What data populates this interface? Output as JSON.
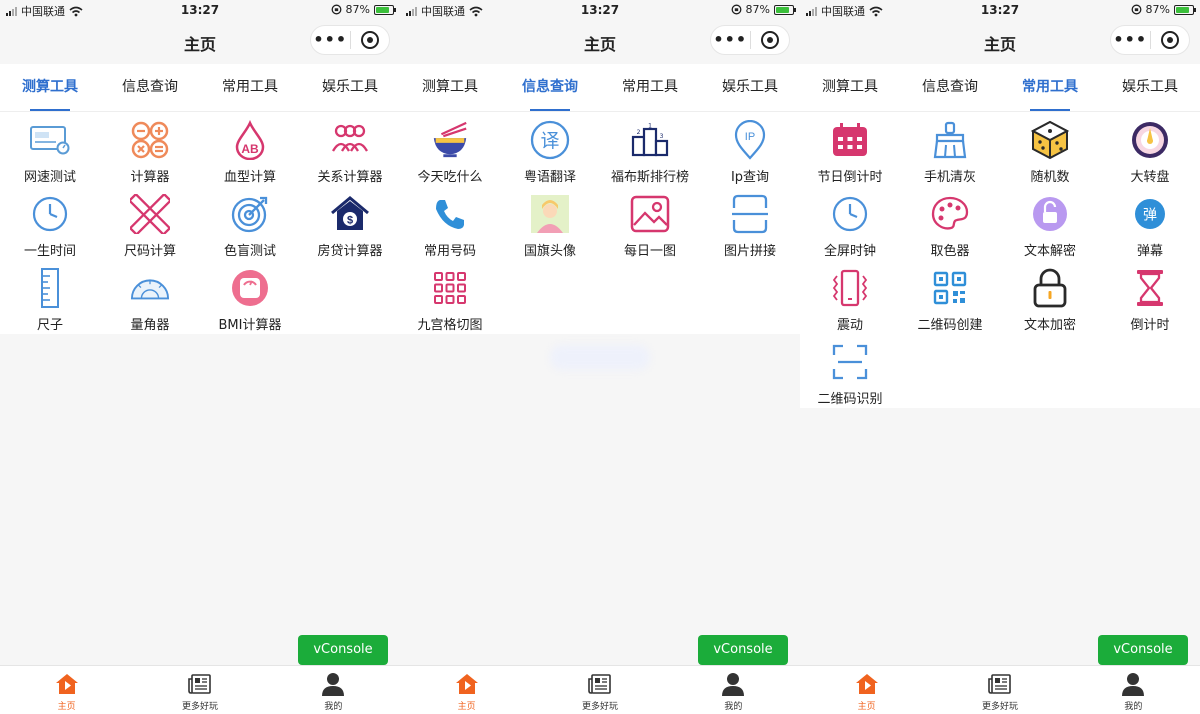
{
  "status": {
    "carrier": "中国联通",
    "time": "13:27",
    "battery": "87%"
  },
  "nav": {
    "title": "主页",
    "more": "•••"
  },
  "tabs": [
    "测算工具",
    "信息查询",
    "常用工具",
    "娱乐工具"
  ],
  "screens": [
    {
      "active_tab": 0,
      "items": [
        {
          "label": "网速测试",
          "icon": "speedtest-icon"
        },
        {
          "label": "计算器",
          "icon": "calculator-icon"
        },
        {
          "label": "血型计算",
          "icon": "blood-type-icon"
        },
        {
          "label": "关系计算器",
          "icon": "people-icon"
        },
        {
          "label": "一生时间",
          "icon": "clock-icon"
        },
        {
          "label": "尺码计算",
          "icon": "ruler-pencil-icon"
        },
        {
          "label": "色盲测试",
          "icon": "target-icon"
        },
        {
          "label": "房贷计算器",
          "icon": "house-dollar-icon"
        },
        {
          "label": "尺子",
          "icon": "ruler-icon"
        },
        {
          "label": "量角器",
          "icon": "protractor-icon"
        },
        {
          "label": "BMI计算器",
          "icon": "scale-icon"
        }
      ]
    },
    {
      "active_tab": 1,
      "items": [
        {
          "label": "今天吃什么",
          "icon": "noodle-bowl-icon"
        },
        {
          "label": "粤语翻译",
          "icon": "translate-icon"
        },
        {
          "label": "福布斯排行榜",
          "icon": "podium-icon"
        },
        {
          "label": "Ip查询",
          "icon": "ip-pin-icon"
        },
        {
          "label": "常用号码",
          "icon": "phone-icon"
        },
        {
          "label": "国旗头像",
          "icon": "avatar-flag-icon"
        },
        {
          "label": "每日一图",
          "icon": "image-icon"
        },
        {
          "label": "图片拼接",
          "icon": "image-stitch-icon"
        },
        {
          "label": "九宫格切图",
          "icon": "grid-nine-icon"
        }
      ]
    },
    {
      "active_tab": 2,
      "items": [
        {
          "label": "节日倒计时",
          "icon": "calendar-icon"
        },
        {
          "label": "手机清灰",
          "icon": "broom-icon"
        },
        {
          "label": "随机数",
          "icon": "dice-icon"
        },
        {
          "label": "大转盘",
          "icon": "wheel-icon"
        },
        {
          "label": "全屏时钟",
          "icon": "clock-icon"
        },
        {
          "label": "取色器",
          "icon": "palette-icon"
        },
        {
          "label": "文本解密",
          "icon": "unlock-icon"
        },
        {
          "label": "弹幕",
          "icon": "danmu-icon"
        },
        {
          "label": "震动",
          "icon": "vibrate-icon"
        },
        {
          "label": "二维码创建",
          "icon": "qrcode-icon"
        },
        {
          "label": "文本加密",
          "icon": "lock-icon"
        },
        {
          "label": "倒计时",
          "icon": "hourglass-icon"
        },
        {
          "label": "二维码识别",
          "icon": "scan-icon"
        }
      ]
    }
  ],
  "danmu_glyph": "弹",
  "vconsole": "vConsole",
  "tabbar": [
    {
      "label": "主页",
      "icon": "home-icon"
    },
    {
      "label": "更多好玩",
      "icon": "news-icon"
    },
    {
      "label": "我的",
      "icon": "user-icon"
    }
  ],
  "colors": {
    "accent": "#2f6fce",
    "tabbar_active": "#f0631f",
    "vconsole_bg": "#1bac3a"
  }
}
